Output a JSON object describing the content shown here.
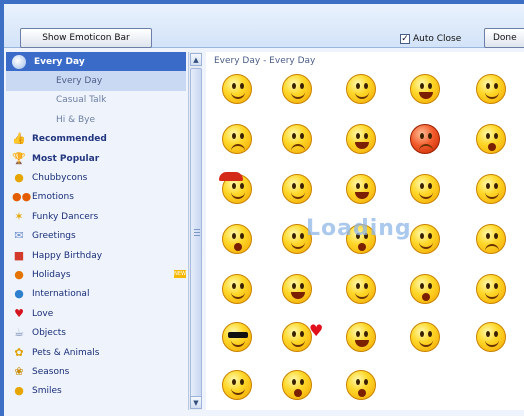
{
  "toolbar": {
    "show_button_label": "Show Emoticon Bar",
    "auto_close_label": "Auto Close",
    "auto_close_checked": true,
    "done_button_label": "Done"
  },
  "sidebar": {
    "header": {
      "label": "Every Day",
      "icon": "sun-icon"
    },
    "subitems": [
      {
        "label": "Every Day",
        "selected": true
      },
      {
        "label": "Casual Talk",
        "selected": false
      },
      {
        "label": "Hi & Bye",
        "selected": false
      }
    ],
    "categories": [
      {
        "label": "Recommended",
        "icon": "thumbs-up-icon",
        "bold": true
      },
      {
        "label": "Most Popular",
        "icon": "trophy-icon",
        "bold": true
      },
      {
        "label": "Chubbycons",
        "icon": "smiley-icon",
        "bold": false
      },
      {
        "label": "Emotions",
        "icon": "faces-icon",
        "bold": false
      },
      {
        "label": "Funky Dancers",
        "icon": "dancer-icon",
        "bold": false
      },
      {
        "label": "Greetings",
        "icon": "card-icon",
        "bold": false
      },
      {
        "label": "Happy Birthday",
        "icon": "gift-icon",
        "bold": false
      },
      {
        "label": "Holidays",
        "icon": "pumpkin-icon",
        "bold": false,
        "badge": "NEW"
      },
      {
        "label": "International",
        "icon": "globe-icon",
        "bold": false
      },
      {
        "label": "Love",
        "icon": "heart-icon",
        "bold": false
      },
      {
        "label": "Objects",
        "icon": "teacup-icon",
        "bold": false
      },
      {
        "label": "Pets & Animals",
        "icon": "paw-icon",
        "bold": false
      },
      {
        "label": "Seasons",
        "icon": "leaf-icon",
        "bold": false
      },
      {
        "label": "Smiles",
        "icon": "smile-icon",
        "bold": false
      }
    ]
  },
  "content": {
    "breadcrumb": "Every Day - Every Day",
    "loading_text": "Loading",
    "emoticons": [
      "happy-face-icon",
      "winking-face-icon",
      "smiling-face-icon",
      "laughing-face-icon",
      "covering-eyes-face-icon",
      "worried-face-icon",
      "sad-face-icon",
      "crying-face-icon",
      "angry-face-icon",
      "shocked-face-icon",
      "cap-face-icon",
      "blushing-face-icon",
      "grinning-face-icon",
      "smirk-face-icon",
      "tongue-face-icon",
      "eyes-rolling-face-icon",
      "sleepy-face-icon",
      "kissing-face-icon",
      "thumbs-up-face-icon",
      "thumbs-down-face-icon",
      "waving-face-icon",
      "bouncing-face-icon",
      "thinking-face-icon",
      "praying-face-icon",
      "hand-up-face-icon",
      "sunglasses-face-icon",
      "love-face-icon",
      "cheering-face-icon",
      "nervous-face-icon",
      "angel-face-icon",
      "party-face-icon",
      "gift-face-icon",
      "bubble-face-icon"
    ]
  },
  "colors": {
    "frame": "#3d6fc4",
    "sidebar_header": "#3b6bc8",
    "selected_item": "#c9d9f3",
    "link_text": "#1a2e78",
    "smiley_yellow": "#ffd82a"
  }
}
